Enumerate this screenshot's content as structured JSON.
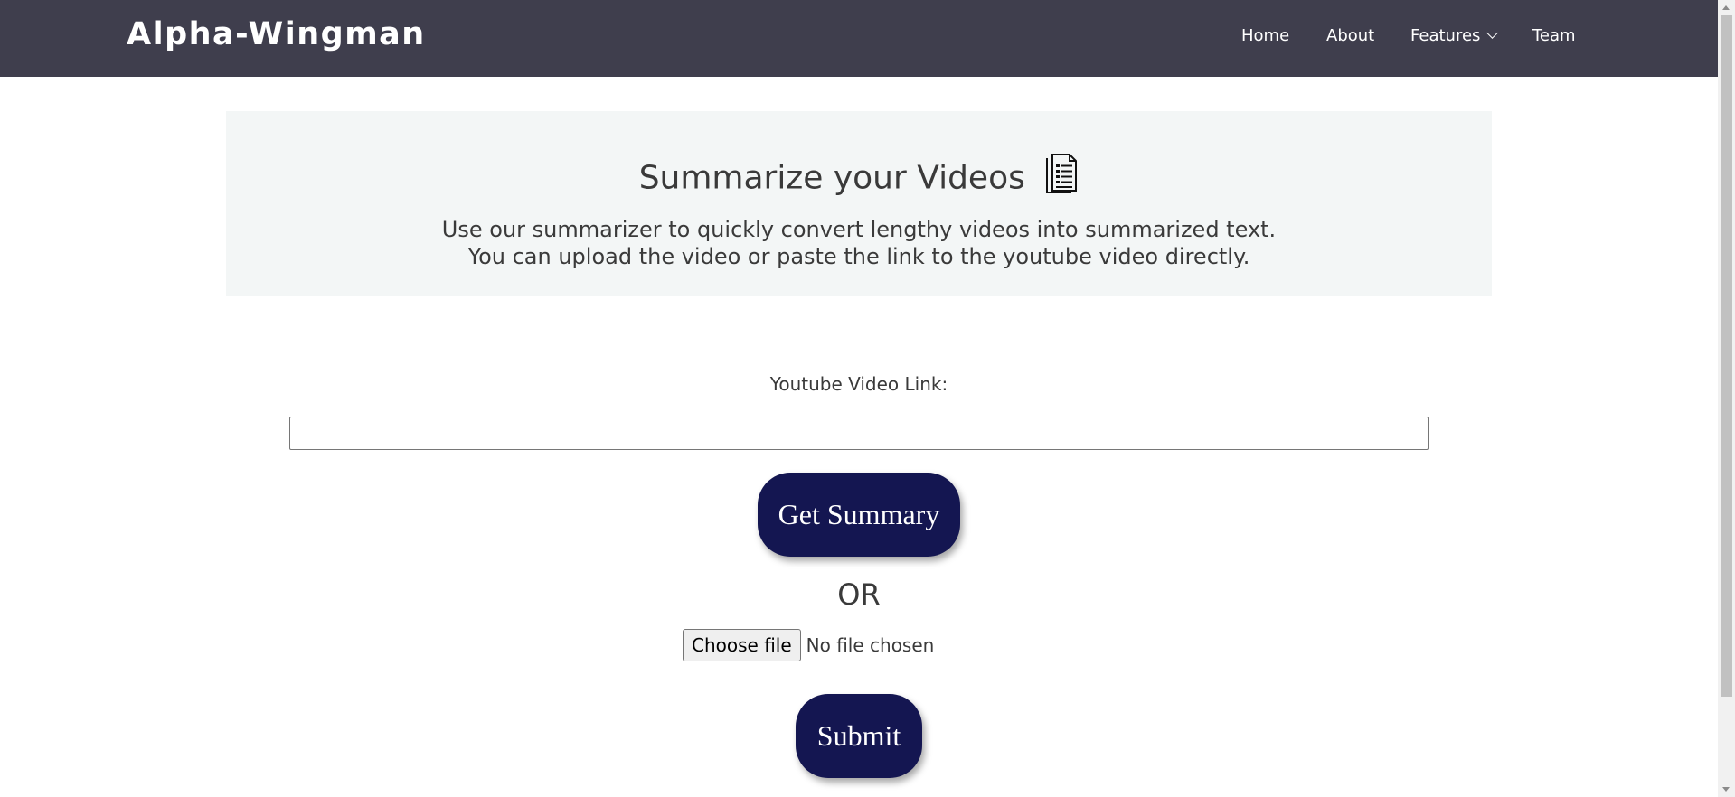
{
  "header": {
    "brand": "Alpha-Wingman",
    "nav": [
      {
        "label": "Home"
      },
      {
        "label": "About"
      },
      {
        "label": "Features",
        "has_dropdown": true
      },
      {
        "label": "Team"
      }
    ]
  },
  "hero": {
    "title": "Summarize your Videos",
    "title_icon": "document-icon",
    "description_line1": "Use our summarizer to quickly convert lengthy videos into summarized text.",
    "description_line2": "You can upload the video or paste the link to the youtube video directly."
  },
  "form": {
    "link_label": "Youtube Video Link:",
    "link_value": "",
    "link_placeholder": "",
    "get_summary_label": "Get Summary",
    "or_text": "OR",
    "choose_file_label": "Choose file",
    "file_status": "No file chosen",
    "submit_label": "Submit"
  },
  "colors": {
    "header_bg": "#3f3e4d",
    "hero_bg": "#f3f6f6",
    "button_bg": "#141651",
    "text": "#3a3a3a"
  }
}
